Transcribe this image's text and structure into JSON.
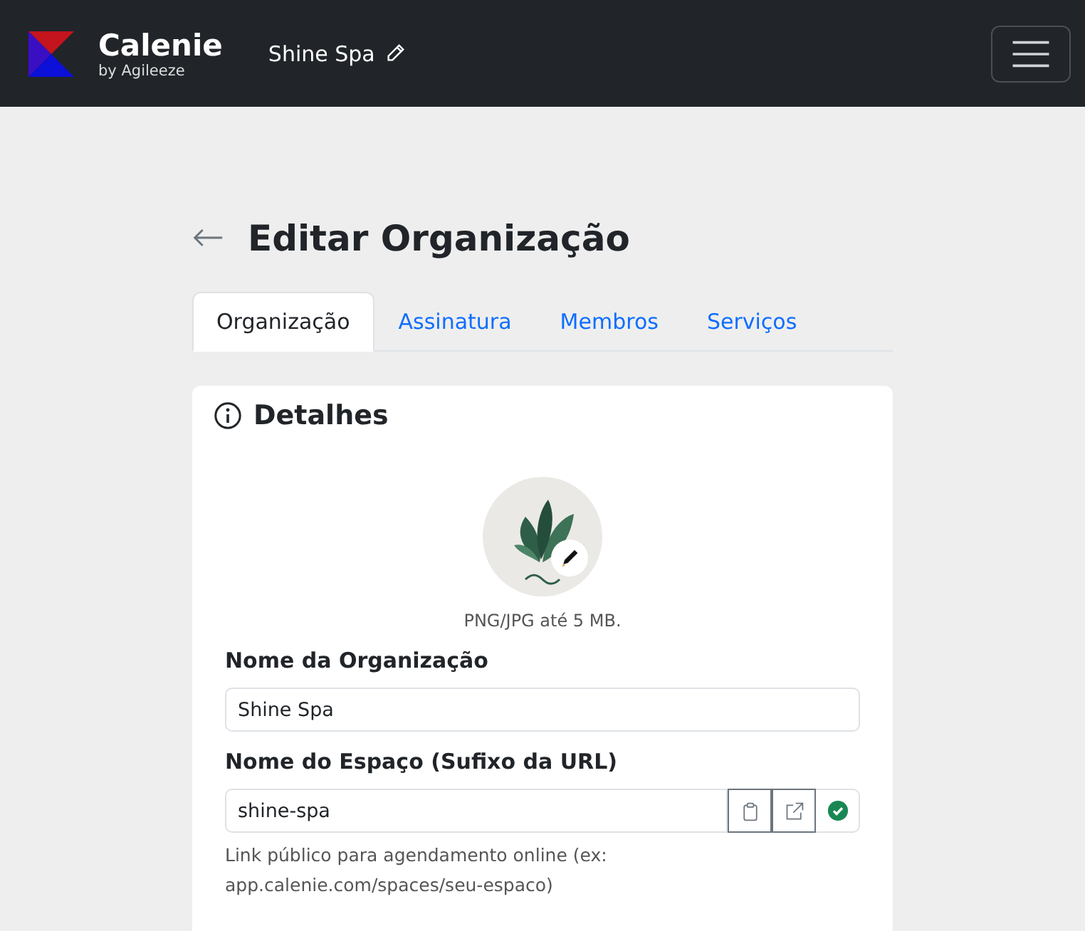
{
  "navbar": {
    "brand": "Calenie",
    "tagline": "by Agileeze",
    "organization": "Shine Spa"
  },
  "page": {
    "title": "Editar Organização"
  },
  "tabs": [
    {
      "label": "Organização",
      "selected": true
    },
    {
      "label": "Assinatura",
      "selected": false
    },
    {
      "label": "Membros",
      "selected": false
    },
    {
      "label": "Serviços",
      "selected": false
    }
  ],
  "card": {
    "title": "Detalhes",
    "logo_hint": "PNG/JPG até 5 MB.",
    "fields": [
      {
        "label": "Nome da Organização",
        "value": "Shine Spa",
        "kind": "text"
      },
      {
        "label": "Nome do Espaço (Sufixo da URL)",
        "value": "shine-spa",
        "kind": "slug",
        "valid": true,
        "help": "Link público para agendamento online (ex: app.calenie.com/spaces/seu-espaco)"
      }
    ]
  }
}
